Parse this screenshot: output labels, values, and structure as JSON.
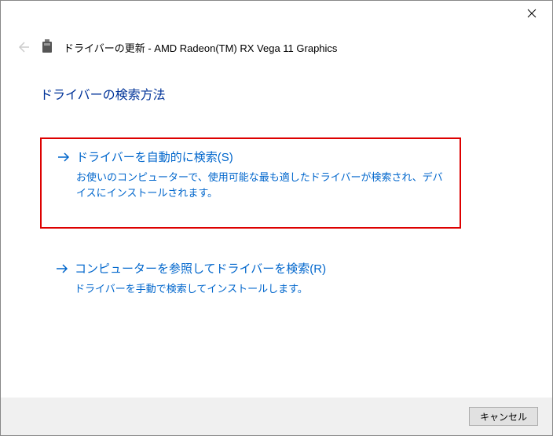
{
  "header": {
    "title": "ドライバーの更新 - AMD Radeon(TM) RX Vega 11 Graphics"
  },
  "heading": "ドライバーの検索方法",
  "options": {
    "auto": {
      "title": "ドライバーを自動的に検索(S)",
      "desc": "お使いのコンピューターで、使用可能な最も適したドライバーが検索され、デバイスにインストールされます。"
    },
    "browse": {
      "title": "コンピューターを参照してドライバーを検索(R)",
      "desc": "ドライバーを手動で検索してインストールします。"
    }
  },
  "footer": {
    "cancel": "キャンセル"
  }
}
